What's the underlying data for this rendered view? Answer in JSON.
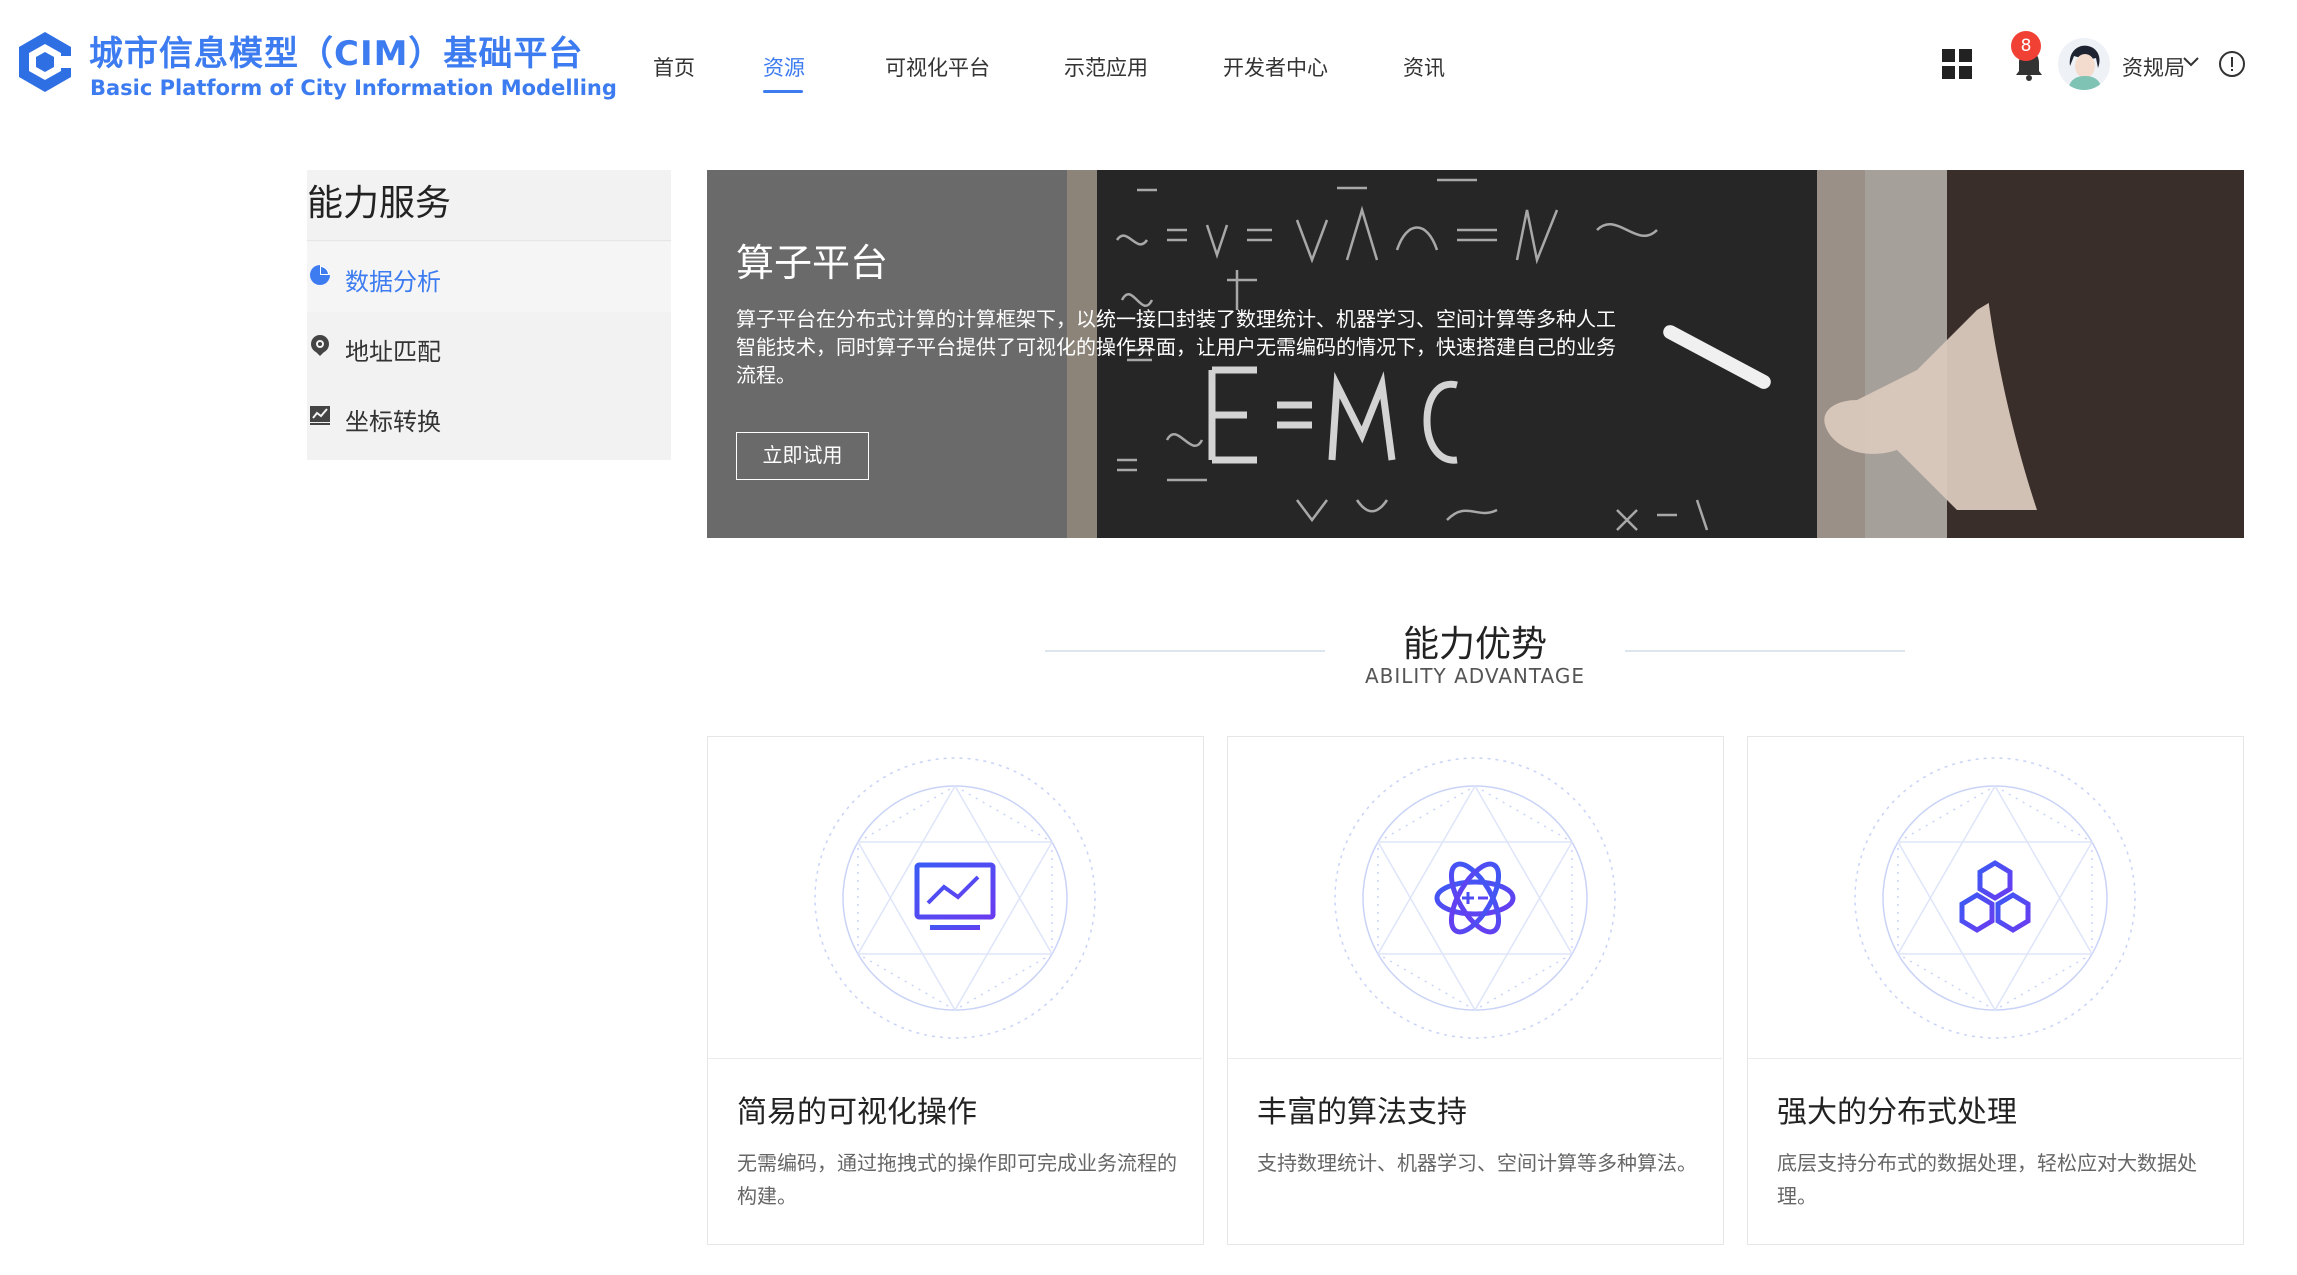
{
  "brand": {
    "title_cn": "城市信息模型（CIM）基础平台",
    "title_en": "Basic Platform of City Information Modelling"
  },
  "nav": {
    "items": [
      {
        "label": "首页",
        "active": false
      },
      {
        "label": "资源",
        "active": true
      },
      {
        "label": "可视化平台",
        "active": false
      },
      {
        "label": "示范应用",
        "active": false
      },
      {
        "label": "开发者中心",
        "active": false
      },
      {
        "label": "资讯",
        "active": false
      }
    ]
  },
  "header": {
    "notification_count": "8",
    "username": "资规局",
    "icons": [
      "apps-grid-icon",
      "bell-icon",
      "avatar",
      "chevron-down-icon",
      "info-icon"
    ]
  },
  "sidebar": {
    "title": "能力服务",
    "items": [
      {
        "label": "数据分析",
        "icon": "pie-chart-icon",
        "active": true
      },
      {
        "label": "地址匹配",
        "icon": "location-pin-icon",
        "active": false
      },
      {
        "label": "坐标转换",
        "icon": "line-chart-icon",
        "active": false
      }
    ]
  },
  "banner": {
    "title": "算子平台",
    "description": "算子平台在分布式计算的计算框架下，以统一接口封装了数理统计、机器学习、空间计算等多种人工智能技术，同时算子平台提供了可视化的操作界面，让用户无需编码的情况下，快速搭建自己的业务流程。",
    "button_label": "立即试用"
  },
  "advantage": {
    "title": "能力优势",
    "subtitle": "ABILITY ADVANTAGE",
    "cards": [
      {
        "title": "简易的可视化操作",
        "desc": "无需编码，通过拖拽式的操作即可完成业务流程的构建。",
        "icon": "monitor-chart-icon"
      },
      {
        "title": "丰富的算法支持",
        "desc": "支持数理统计、机器学习、空间计算等多种算法。",
        "icon": "atom-icon"
      },
      {
        "title": "强大的分布式处理",
        "desc": "底层支持分布式的数据处理，轻松应对大数据处理。",
        "icon": "hexagons-icon"
      }
    ]
  },
  "colors": {
    "accent": "#3d7cf0",
    "icon_gradient_start": "#3b5bf5",
    "icon_gradient_end": "#6a3bf0",
    "badge": "#f04134"
  }
}
